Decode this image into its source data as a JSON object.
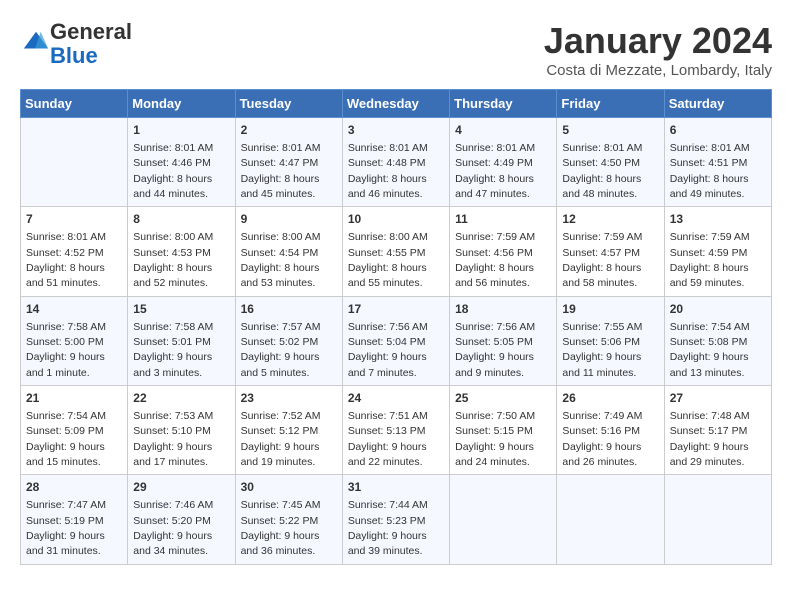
{
  "logo": {
    "general": "General",
    "blue": "Blue"
  },
  "header": {
    "title": "January 2024",
    "subtitle": "Costa di Mezzate, Lombardy, Italy"
  },
  "weekdays": [
    "Sunday",
    "Monday",
    "Tuesday",
    "Wednesday",
    "Thursday",
    "Friday",
    "Saturday"
  ],
  "weeks": [
    [
      {
        "day": "",
        "sunrise": "",
        "sunset": "",
        "daylight": ""
      },
      {
        "day": "1",
        "sunrise": "Sunrise: 8:01 AM",
        "sunset": "Sunset: 4:46 PM",
        "daylight": "Daylight: 8 hours and 44 minutes."
      },
      {
        "day": "2",
        "sunrise": "Sunrise: 8:01 AM",
        "sunset": "Sunset: 4:47 PM",
        "daylight": "Daylight: 8 hours and 45 minutes."
      },
      {
        "day": "3",
        "sunrise": "Sunrise: 8:01 AM",
        "sunset": "Sunset: 4:48 PM",
        "daylight": "Daylight: 8 hours and 46 minutes."
      },
      {
        "day": "4",
        "sunrise": "Sunrise: 8:01 AM",
        "sunset": "Sunset: 4:49 PM",
        "daylight": "Daylight: 8 hours and 47 minutes."
      },
      {
        "day": "5",
        "sunrise": "Sunrise: 8:01 AM",
        "sunset": "Sunset: 4:50 PM",
        "daylight": "Daylight: 8 hours and 48 minutes."
      },
      {
        "day": "6",
        "sunrise": "Sunrise: 8:01 AM",
        "sunset": "Sunset: 4:51 PM",
        "daylight": "Daylight: 8 hours and 49 minutes."
      }
    ],
    [
      {
        "day": "7",
        "sunrise": "Sunrise: 8:01 AM",
        "sunset": "Sunset: 4:52 PM",
        "daylight": "Daylight: 8 hours and 51 minutes."
      },
      {
        "day": "8",
        "sunrise": "Sunrise: 8:00 AM",
        "sunset": "Sunset: 4:53 PM",
        "daylight": "Daylight: 8 hours and 52 minutes."
      },
      {
        "day": "9",
        "sunrise": "Sunrise: 8:00 AM",
        "sunset": "Sunset: 4:54 PM",
        "daylight": "Daylight: 8 hours and 53 minutes."
      },
      {
        "day": "10",
        "sunrise": "Sunrise: 8:00 AM",
        "sunset": "Sunset: 4:55 PM",
        "daylight": "Daylight: 8 hours and 55 minutes."
      },
      {
        "day": "11",
        "sunrise": "Sunrise: 7:59 AM",
        "sunset": "Sunset: 4:56 PM",
        "daylight": "Daylight: 8 hours and 56 minutes."
      },
      {
        "day": "12",
        "sunrise": "Sunrise: 7:59 AM",
        "sunset": "Sunset: 4:57 PM",
        "daylight": "Daylight: 8 hours and 58 minutes."
      },
      {
        "day": "13",
        "sunrise": "Sunrise: 7:59 AM",
        "sunset": "Sunset: 4:59 PM",
        "daylight": "Daylight: 8 hours and 59 minutes."
      }
    ],
    [
      {
        "day": "14",
        "sunrise": "Sunrise: 7:58 AM",
        "sunset": "Sunset: 5:00 PM",
        "daylight": "Daylight: 9 hours and 1 minute."
      },
      {
        "day": "15",
        "sunrise": "Sunrise: 7:58 AM",
        "sunset": "Sunset: 5:01 PM",
        "daylight": "Daylight: 9 hours and 3 minutes."
      },
      {
        "day": "16",
        "sunrise": "Sunrise: 7:57 AM",
        "sunset": "Sunset: 5:02 PM",
        "daylight": "Daylight: 9 hours and 5 minutes."
      },
      {
        "day": "17",
        "sunrise": "Sunrise: 7:56 AM",
        "sunset": "Sunset: 5:04 PM",
        "daylight": "Daylight: 9 hours and 7 minutes."
      },
      {
        "day": "18",
        "sunrise": "Sunrise: 7:56 AM",
        "sunset": "Sunset: 5:05 PM",
        "daylight": "Daylight: 9 hours and 9 minutes."
      },
      {
        "day": "19",
        "sunrise": "Sunrise: 7:55 AM",
        "sunset": "Sunset: 5:06 PM",
        "daylight": "Daylight: 9 hours and 11 minutes."
      },
      {
        "day": "20",
        "sunrise": "Sunrise: 7:54 AM",
        "sunset": "Sunset: 5:08 PM",
        "daylight": "Daylight: 9 hours and 13 minutes."
      }
    ],
    [
      {
        "day": "21",
        "sunrise": "Sunrise: 7:54 AM",
        "sunset": "Sunset: 5:09 PM",
        "daylight": "Daylight: 9 hours and 15 minutes."
      },
      {
        "day": "22",
        "sunrise": "Sunrise: 7:53 AM",
        "sunset": "Sunset: 5:10 PM",
        "daylight": "Daylight: 9 hours and 17 minutes."
      },
      {
        "day": "23",
        "sunrise": "Sunrise: 7:52 AM",
        "sunset": "Sunset: 5:12 PM",
        "daylight": "Daylight: 9 hours and 19 minutes."
      },
      {
        "day": "24",
        "sunrise": "Sunrise: 7:51 AM",
        "sunset": "Sunset: 5:13 PM",
        "daylight": "Daylight: 9 hours and 22 minutes."
      },
      {
        "day": "25",
        "sunrise": "Sunrise: 7:50 AM",
        "sunset": "Sunset: 5:15 PM",
        "daylight": "Daylight: 9 hours and 24 minutes."
      },
      {
        "day": "26",
        "sunrise": "Sunrise: 7:49 AM",
        "sunset": "Sunset: 5:16 PM",
        "daylight": "Daylight: 9 hours and 26 minutes."
      },
      {
        "day": "27",
        "sunrise": "Sunrise: 7:48 AM",
        "sunset": "Sunset: 5:17 PM",
        "daylight": "Daylight: 9 hours and 29 minutes."
      }
    ],
    [
      {
        "day": "28",
        "sunrise": "Sunrise: 7:47 AM",
        "sunset": "Sunset: 5:19 PM",
        "daylight": "Daylight: 9 hours and 31 minutes."
      },
      {
        "day": "29",
        "sunrise": "Sunrise: 7:46 AM",
        "sunset": "Sunset: 5:20 PM",
        "daylight": "Daylight: 9 hours and 34 minutes."
      },
      {
        "day": "30",
        "sunrise": "Sunrise: 7:45 AM",
        "sunset": "Sunset: 5:22 PM",
        "daylight": "Daylight: 9 hours and 36 minutes."
      },
      {
        "day": "31",
        "sunrise": "Sunrise: 7:44 AM",
        "sunset": "Sunset: 5:23 PM",
        "daylight": "Daylight: 9 hours and 39 minutes."
      },
      {
        "day": "",
        "sunrise": "",
        "sunset": "",
        "daylight": ""
      },
      {
        "day": "",
        "sunrise": "",
        "sunset": "",
        "daylight": ""
      },
      {
        "day": "",
        "sunrise": "",
        "sunset": "",
        "daylight": ""
      }
    ]
  ]
}
